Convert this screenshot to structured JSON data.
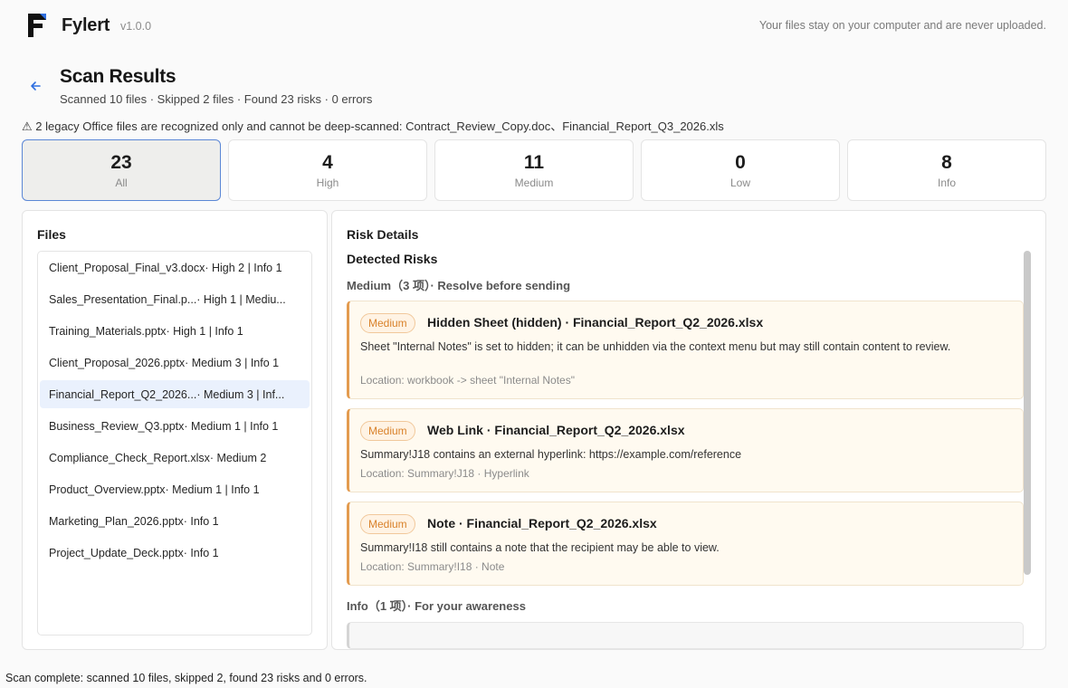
{
  "app": {
    "name": "Fylert",
    "version": "v1.0.0",
    "privacy_note": "Your files stay on your computer and are never uploaded."
  },
  "page": {
    "title": "Scan Results",
    "summary": "Scanned 10 files · Skipped 2 files · Found 23 risks · 0 errors",
    "legacy_warning": "⚠ 2 legacy Office files are recognized only and cannot be deep-scanned: Contract_Review_Copy.doc、Financial_Report_Q3_2026.xls"
  },
  "stats": [
    {
      "value": "23",
      "label": "All",
      "active": true
    },
    {
      "value": "4",
      "label": "High"
    },
    {
      "value": "11",
      "label": "Medium"
    },
    {
      "value": "0",
      "label": "Low"
    },
    {
      "value": "8",
      "label": "Info"
    }
  ],
  "files": {
    "title": "Files",
    "items": [
      {
        "name": "Client_Proposal_Final_v3.docx",
        "meta": " · High 2 | Info 1"
      },
      {
        "name": "Sales_Presentation_Final.p...",
        "meta": " · High 1 | Mediu..."
      },
      {
        "name": "Training_Materials.pptx",
        "meta": " · High 1 | Info 1"
      },
      {
        "name": "Client_Proposal_2026.pptx",
        "meta": " · Medium 3 | Info 1"
      },
      {
        "name": "Financial_Report_Q2_2026...",
        "meta": " · Medium 3 | Inf...",
        "selected": true
      },
      {
        "name": "Business_Review_Q3.pptx",
        "meta": " · Medium 1 | Info 1"
      },
      {
        "name": "Compliance_Check_Report.xlsx",
        "meta": " · Medium 2"
      },
      {
        "name": "Product_Overview.pptx",
        "meta": " · Medium 1 | Info 1"
      },
      {
        "name": "Marketing_Plan_2026.pptx",
        "meta": " · Info 1"
      },
      {
        "name": "Project_Update_Deck.pptx",
        "meta": " · Info 1"
      }
    ]
  },
  "risk_details": {
    "title": "Risk Details",
    "detected_title": "Detected Risks",
    "medium_heading": "Medium（3 项）· Resolve before sending",
    "info_heading": "Info（1 项）· For your awareness",
    "cards": [
      {
        "badge": "Medium",
        "title": "Hidden Sheet (hidden) · Financial_Report_Q2_2026.xlsx",
        "description": "Sheet \"Internal Notes\" is set to hidden; it can be unhidden via the context menu but may still contain content to review.",
        "location": "Location: workbook -> sheet \"Internal Notes\""
      },
      {
        "badge": "Medium",
        "title": "Web Link · Financial_Report_Q2_2026.xlsx",
        "description": "Summary!J18 contains an external hyperlink: https://example.com/reference",
        "location": "Location: Summary!J18 · Hyperlink"
      },
      {
        "badge": "Medium",
        "title": "Note · Financial_Report_Q2_2026.xlsx",
        "description": "Summary!I18 still contains a note that the recipient may be able to view.",
        "location": "Location: Summary!I18 · Note"
      }
    ]
  },
  "status_bar": "Scan complete: scanned 10 files, skipped 2, found 23 risks and 0 errors.",
  "colors": {
    "accent": "#2f6fe0",
    "medium": "#d9822b",
    "selected_row": "#eaf1fd"
  }
}
